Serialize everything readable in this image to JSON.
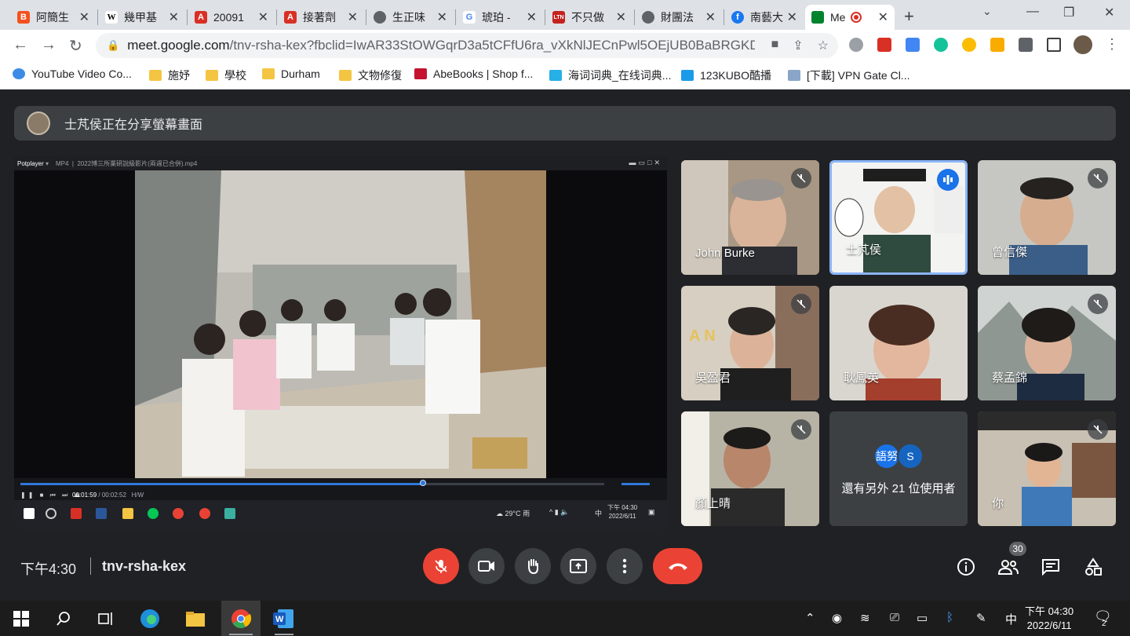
{
  "browser": {
    "tabs": [
      {
        "label": "阿簡生",
        "favicon_color": "#f4511e",
        "active": false
      },
      {
        "label": "幾甲基",
        "favicon_color": "#ffffff",
        "active": false
      },
      {
        "label": "20091",
        "favicon_color": "#d93025",
        "active": false
      },
      {
        "label": "接著劑",
        "favicon_color": "#d93025",
        "active": false
      },
      {
        "label": "生正味",
        "favicon_color": "#5f6368",
        "active": false
      },
      {
        "label": "琥珀 -",
        "favicon_color": "#4285f4",
        "active": false
      },
      {
        "label": "不只做",
        "favicon_color": "#c5221f",
        "active": false
      },
      {
        "label": "財團法",
        "favicon_color": "#5f6368",
        "active": false
      },
      {
        "label": "南藝大",
        "favicon_color": "#1877f2",
        "active": false
      },
      {
        "label": "Me",
        "favicon_color": "#00832d",
        "active": true
      }
    ],
    "url_host": "meet.google.com",
    "url_path": "/tnv-rsha-kex?fbclid=IwAR33StOWGqrD3a5tCFfU6ra_vXkNlJECnPwl5OEjUB0BaBRGKDn...",
    "bookmarks": [
      {
        "label": "YouTube Video Co...",
        "icon": "youtube-icon"
      },
      {
        "label": "施妤",
        "icon": "folder-icon"
      },
      {
        "label": "學校",
        "icon": "folder-icon"
      },
      {
        "label": "Durham",
        "icon": "folder-icon"
      },
      {
        "label": "文物修復",
        "icon": "folder-icon"
      },
      {
        "label": "AbeBooks | Shop f...",
        "icon": "abebooks-icon"
      },
      {
        "label": "海词词典_在线词典...",
        "icon": "dict-icon"
      },
      {
        "label": "123KUBO酷播",
        "icon": "kubo-icon"
      },
      {
        "label": "[下載] VPN Gate Cl...",
        "icon": "vpn-icon"
      }
    ]
  },
  "meet": {
    "banner_text": "士芃侯正在分享螢幕畫面",
    "shared_screen": {
      "player_brand": "Potplayer",
      "player_format": "MP4",
      "file_title": "2022博三所業研說級影片(兩週已合併).mp4",
      "elapsed": "00:01:59",
      "duration": "00:02:52",
      "mode": "H/W",
      "progress_fraction": 0.69,
      "weather": "29°C 雨",
      "ime": "中",
      "time": "下午 04:30",
      "date": "2022/6/11"
    },
    "participants": [
      {
        "name": "John Burke",
        "muted": true,
        "speaking": false
      },
      {
        "name": "士芃侯",
        "muted": false,
        "speaking": true
      },
      {
        "name": "曾信傑",
        "muted": true,
        "speaking": false
      },
      {
        "name": "吳盈君",
        "muted": true,
        "speaking": false
      },
      {
        "name": "耿鳳英",
        "muted": false,
        "speaking": false
      },
      {
        "name": "蔡孟錦",
        "muted": true,
        "speaking": false
      },
      {
        "name": "顏上晴",
        "muted": true,
        "speaking": false
      },
      {
        "name": "你",
        "muted": true,
        "speaking": false
      }
    ],
    "others": {
      "avatars": [
        {
          "label": "語努",
          "color": "#1a73e8"
        },
        {
          "label": "S",
          "color": "#1565c0"
        }
      ],
      "text": "還有另外 21 位使用者"
    },
    "footer": {
      "time": "下午4:30",
      "meeting_code": "tnv-rsha-kex",
      "participant_count": "30"
    },
    "colors": {
      "end_call": "#ea4335",
      "mic_off": "#ea4335",
      "speaking_border": "#8ab4f8"
    }
  },
  "taskbar": {
    "ime": "中",
    "time": "下午 04:30",
    "date": "2022/6/11",
    "notification_count": "2"
  }
}
